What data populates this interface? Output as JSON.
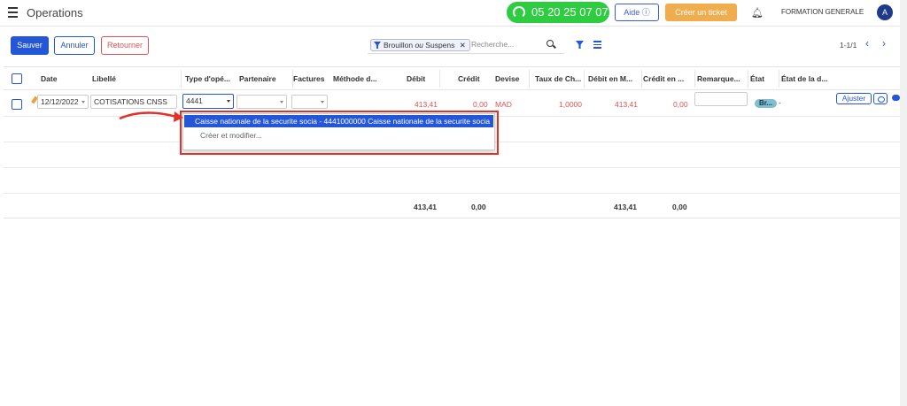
{
  "app": {
    "title": "Operations",
    "phone": "05 20 25 07 07",
    "help_label": "Aide",
    "ticket_label": "Créer un ticket",
    "company": "FORMATION GENERALE",
    "avatar_letter": "A"
  },
  "toolbar": {
    "save_label": "Sauver",
    "cancel_label": "Annuler",
    "return_label": "Retourner"
  },
  "search": {
    "facet_left": "Brouillon",
    "facet_or": "ou",
    "facet_right": "Suspens",
    "placeholder": "Recherche..."
  },
  "pager": {
    "text": "1-1/1"
  },
  "table": {
    "columns": [
      "Date",
      "Libellé",
      "Type d'opé...",
      "Partenaire",
      "Factures",
      "Méthode d...",
      "Débit",
      "Crédit",
      "Devise",
      "Taux de Ch...",
      "Débit en M...",
      "Crédit en ...",
      "Remarque...",
      "État",
      "État de la d..."
    ],
    "row": {
      "date": "12/12/2022",
      "libelle": "COTISATIONS CNSS",
      "type_op": "4441",
      "debit": "413,41",
      "credit": "0,00",
      "devise": "MAD",
      "taux": "1,0000",
      "debit_m": "413,41",
      "credit_m": "0,00",
      "etat": "Br...",
      "etat_dash": "-",
      "adjust_label": "Ajuster"
    },
    "totals": {
      "debit": "413,41",
      "credit": "0,00",
      "debit_m": "413,41",
      "credit_m": "0,00"
    }
  },
  "dropdown": {
    "items": [
      "Caisse nationale de la securite socia - 4441000000 Caisse nationale de la securite socia",
      "Créer et modifier..."
    ]
  },
  "colors": {
    "primary": "#2456d8",
    "danger": "#e05252",
    "phone_green": "#2ecc40",
    "ticket_orange": "#f0ad4e",
    "highlight_box": "#e0322b"
  }
}
